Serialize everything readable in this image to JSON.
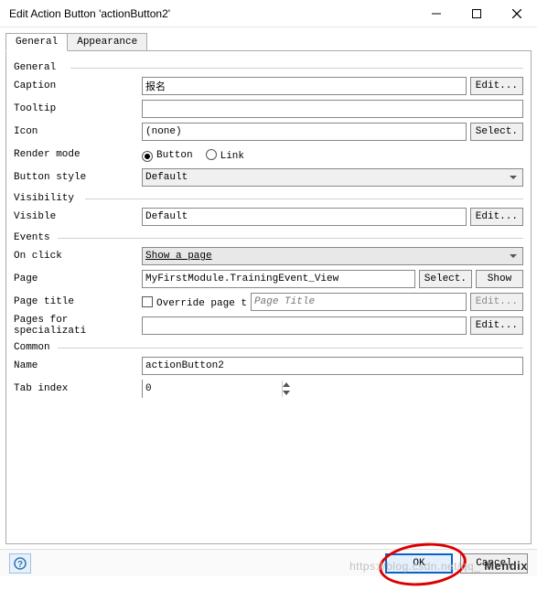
{
  "titlebar": {
    "title": "Edit Action Button 'actionButton2'"
  },
  "tabs": {
    "general": "General",
    "appearance": "Appearance"
  },
  "sections": {
    "general": "General",
    "visibility": "Visibility",
    "events": "Events",
    "common": "Common"
  },
  "general": {
    "caption_label": "Caption",
    "caption_value": "报名",
    "caption_edit": "Edit...",
    "tooltip_label": "Tooltip",
    "tooltip_value": "",
    "icon_label": "Icon",
    "icon_value": "(none)",
    "icon_select": "Select.",
    "render_label": "Render mode",
    "render_button": "Button",
    "render_link": "Link",
    "button_style_label": "Button style",
    "button_style_value": "Default"
  },
  "visibility": {
    "visible_label": "Visible",
    "visible_value": "Default",
    "visible_edit": "Edit..."
  },
  "events": {
    "onclick_label": "On click",
    "onclick_value": "Show a page",
    "page_label": "Page",
    "page_value": "MyFirstModule.TrainingEvent_View",
    "page_select": "Select.",
    "page_show": "Show",
    "page_title_label": "Page title",
    "page_title_override": "Override page t",
    "page_title_placeholder": "Page Title",
    "page_title_edit": "Edit...",
    "specialization_label": "Pages for specializati",
    "specialization_edit": "Edit..."
  },
  "common": {
    "name_label": "Name",
    "name_value": "actionButton2",
    "tabindex_label": "Tab index",
    "tabindex_value": "0"
  },
  "buttons": {
    "ok": "OK",
    "cancel": "Cancel"
  },
  "watermark": {
    "faint": "https://blog.csdn.net/qq_",
    "brand": "Mendix"
  }
}
